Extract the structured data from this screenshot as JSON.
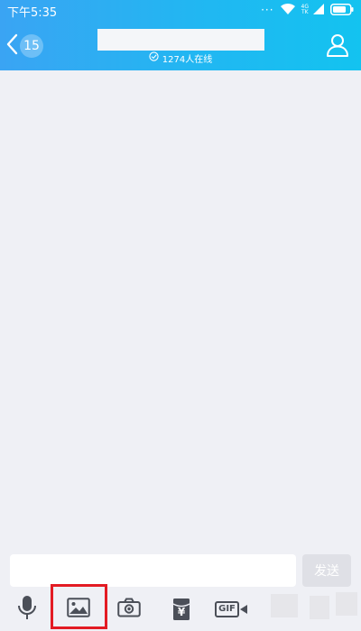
{
  "status_bar": {
    "time": "下午5:35",
    "dots": "···",
    "network_label_top": "4G",
    "network_label_bottom": "TK"
  },
  "titlebar": {
    "unread_count": "15",
    "online_text": "1274人在线"
  },
  "input": {
    "placeholder": "",
    "send_label": "发送"
  },
  "toolbar": {
    "items": [
      {
        "icon": "microphone-icon"
      },
      {
        "icon": "image-icon"
      },
      {
        "icon": "camera-icon"
      },
      {
        "icon": "red-envelope-icon",
        "text": "¥"
      },
      {
        "icon": "gif-video-icon",
        "text": "GIF"
      }
    ]
  },
  "colors": {
    "header_start": "#3aa4f3",
    "header_end": "#13c3f0",
    "background": "#eff0f5",
    "highlight": "#e31b23",
    "icon": "#4b4f58"
  }
}
